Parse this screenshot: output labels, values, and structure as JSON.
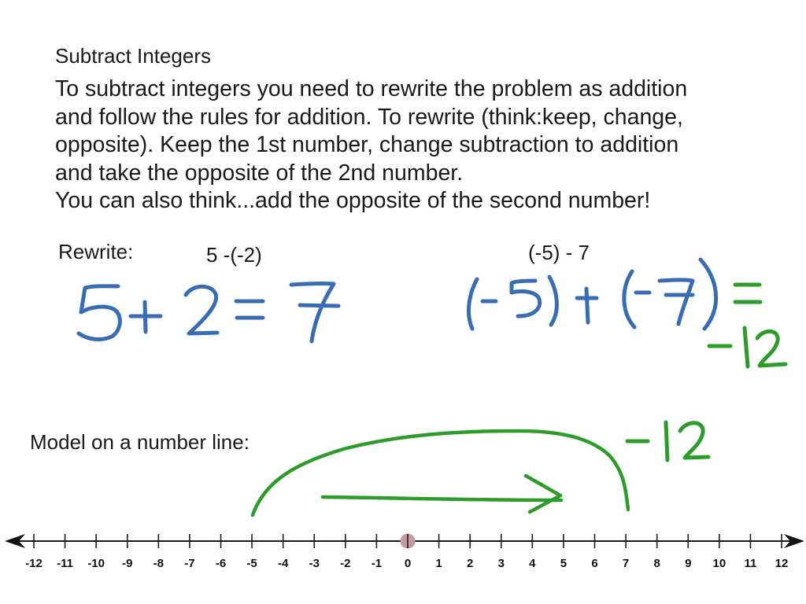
{
  "page": {
    "title": "Subtract Integers",
    "body_lines": [
      "To subtract integers you need to rewrite the problem as addition",
      "and follow the rules for addition.  To rewrite (think:keep, change,",
      "opposite). Keep the 1st number, change subtraction to addition",
      "and take the opposite of the 2nd number.",
      "You can also think...add the opposite of the second number!"
    ],
    "rewrite_label": "Rewrite:",
    "problem_1": "5 -(-2)",
    "problem_2": "(-5) - 7",
    "handwritten": {
      "answer_1": "5 + 2 = 7",
      "answer_2": "(-5) + (-7) =",
      "answer_2_result": "-12",
      "number_line_result": "-12"
    },
    "model_label": "Model on a number line:"
  },
  "colors": {
    "text": "#1a1a1a",
    "blue_ink": "#3a6cb4",
    "green_ink": "#2e9c2a",
    "origin_dot": "#c69aa3"
  },
  "number_line": {
    "min": -12,
    "max": 12,
    "step": 1,
    "tick_labels": [
      "-12",
      "-11",
      "-10",
      "-9",
      "-8",
      "-7",
      "-6",
      "-5",
      "-4",
      "-3",
      "-2",
      "-1",
      "0",
      "1",
      "2",
      "3",
      "4",
      "5",
      "6",
      "7",
      "8",
      "9",
      "10",
      "11",
      "12"
    ],
    "highlighted_point": 0,
    "arc_jump": {
      "from": -5,
      "to": 7
    },
    "arrow": {
      "from": -3,
      "to": 5
    }
  }
}
